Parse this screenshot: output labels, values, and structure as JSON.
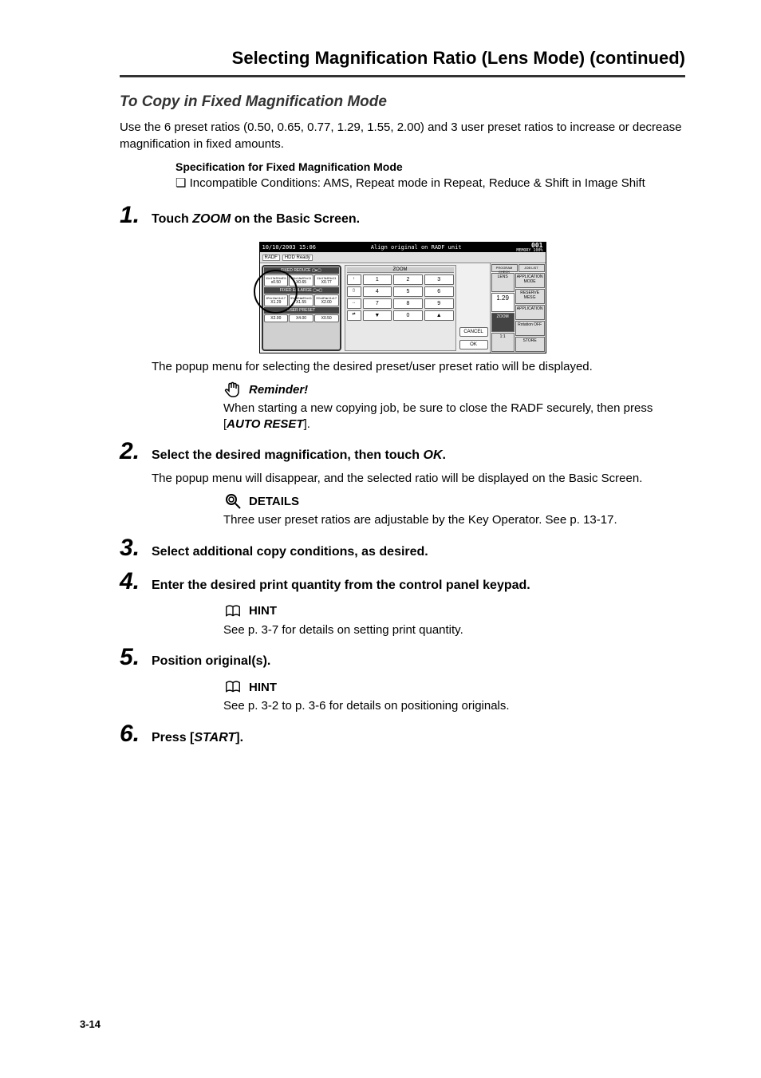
{
  "page_title": "Selecting Magnification Ratio (Lens Mode) (continued)",
  "subtitle": "To Copy in Fixed Magnification Mode",
  "intro": "Use the 6 preset ratios (0.50, 0.65, 0.77, 1.29, 1.55, 2.00) and 3 user preset ratios to increase or decrease magnification in fixed amounts.",
  "spec": {
    "title": "Specification for Fixed Magnification Mode",
    "cond": "❏ Incompatible Conditions: AMS, Repeat mode in Repeat, Reduce & Shift in Image Shift"
  },
  "steps": {
    "s1": {
      "num": "1.",
      "pre": "Touch ",
      "em": "ZOOM",
      "post": " on the Basic Screen."
    },
    "s1_note": "The popup menu for selecting the desired preset/user preset ratio will be displayed.",
    "s2": {
      "num": "2.",
      "pre": "Select the desired magnification, then touch ",
      "em": "OK",
      "post": "."
    },
    "s2_note": "The popup menu will disappear, and the selected ratio will be displayed on the Basic Screen.",
    "s3": {
      "num": "3.",
      "text": "Select additional copy conditions, as desired."
    },
    "s4": {
      "num": "4.",
      "text": "Enter the desired print quantity from the control panel keypad."
    },
    "s5": {
      "num": "5.",
      "text": "Position original(s)."
    },
    "s6": {
      "num": "6.",
      "pre": "Press [",
      "em": "START",
      "post": "]."
    }
  },
  "reminder": {
    "title": "Reminder!",
    "line1": "When starting a new copying job, be sure to close the RADF securely, then press [",
    "em": "AUTO RESET",
    "line2": "]."
  },
  "details": {
    "title": "DETAILS",
    "text": "Three user preset ratios are adjustable by the Key Operator. See p. 13-17."
  },
  "hint4": {
    "title": "HINT",
    "text": "See p. 3-7 for details on setting print quantity."
  },
  "hint5": {
    "title": "HINT",
    "text": "See p. 3-2 to p. 3-6 for details on positioning originals."
  },
  "screenshot": {
    "datetime": "10/10/2003 15:06",
    "message": "Align original on RADF unit",
    "counter": "001",
    "memory": "MEMORY 100%",
    "radf": "RADF",
    "hdd": "HDD Ready",
    "fixed_reduce": "FIXED    REDUCE  ▢▸▢",
    "reduce_row": [
      "11x17▸5½x8½",
      "8½x14▸8½x11",
      "11x17▸8½x11"
    ],
    "reduce_vals": [
      "x0.50",
      "X0.65",
      "X0.77"
    ],
    "fixed_enlarge": "FIXED   ENLARGE  ▢◂▢",
    "enlarge_row": [
      "8½x11▸11x17",
      "5½x8½▸8½x11",
      "5½x8½▸11x17"
    ],
    "enlarge_vals": [
      "X1.29",
      "X1.55",
      "X2.00"
    ],
    "user_preset": "USER PRESET",
    "user_vals": [
      "X2.00",
      "X4.00",
      "X0.50"
    ],
    "zoom_title": "ZOOM",
    "keypad": [
      "1",
      "2",
      "3",
      "4",
      "5",
      "6",
      "7",
      "8",
      "9",
      "▼",
      "0",
      "▲"
    ],
    "cancel": "CANCEL",
    "ok": "OK",
    "tabs": [
      "PROGRAM CHECK",
      "JOB LIST"
    ],
    "lens": "LENS",
    "lens_val": "1.29",
    "app_mode": "APPLICATION MODE",
    "reserve": "RESERVE MESG",
    "application": "APPLICATION",
    "rotation": "Rotation OFF",
    "zoom_btn": "ZOOM",
    "onetoone": "1:1",
    "store": "STORE"
  },
  "page_number": "3-14"
}
